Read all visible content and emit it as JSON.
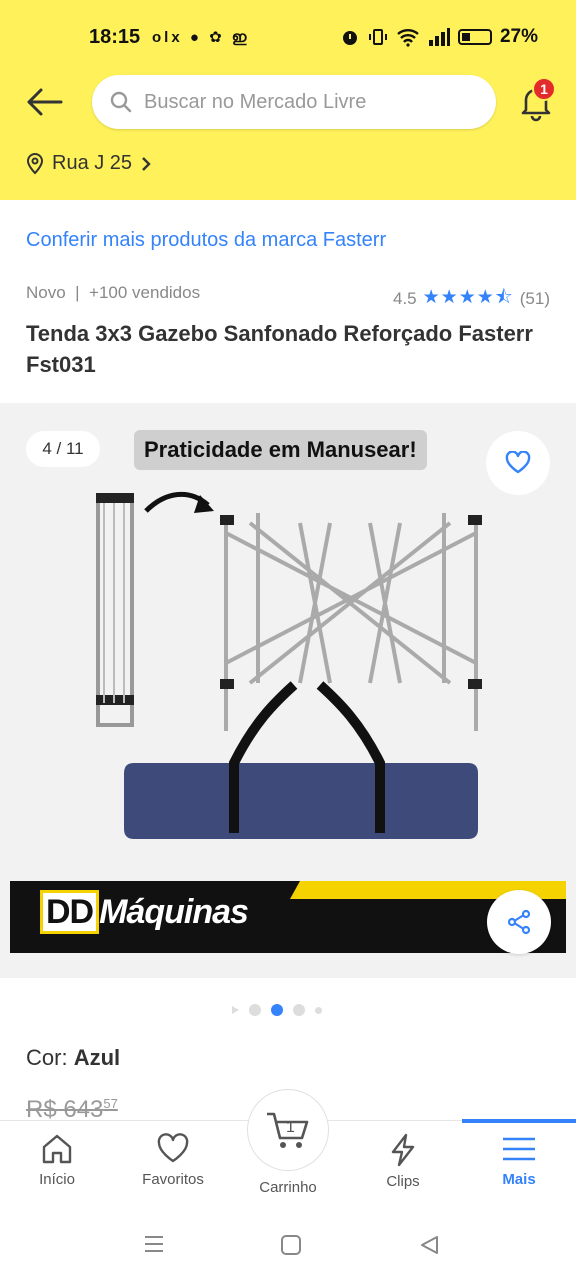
{
  "status_bar": {
    "time": "18:15",
    "app_icons": "olx ● ✿ ഇ",
    "battery": "27%"
  },
  "header": {
    "search_placeholder": "Buscar no Mercado Livre",
    "notification_count": "1",
    "address": "Rua J 25",
    "background_color": "#fff159"
  },
  "product": {
    "brand_link": "Conferir mais produtos da marca Fasterr",
    "condition": "Novo",
    "sold": "+100 vendidos",
    "rating_value": "4.5",
    "rating_count": "(51)",
    "rating_stars": 4.5,
    "title": "Tenda 3x3 Gazebo Sanfonado Reforçado Fasterr Fst031",
    "gallery": {
      "counter": "4 / 11",
      "image_caption": "Praticidade em Manusear!",
      "image_brand": "DDMáquinas",
      "image_brand_dd": "DD",
      "image_brand_rest": "Máquinas"
    },
    "color_label": "Cor: ",
    "color_value": "Azul",
    "old_price": "R$ 643",
    "old_price_cents": "57"
  },
  "bottom_nav": {
    "items": [
      {
        "label": "Início",
        "icon": "home-icon"
      },
      {
        "label": "Favoritos",
        "icon": "heart-icon"
      },
      {
        "label": "Carrinho",
        "icon": "cart-icon",
        "badge": "1"
      },
      {
        "label": "Clips",
        "icon": "bolt-icon"
      },
      {
        "label": "Mais",
        "icon": "menu-icon"
      }
    ],
    "active_color": "#3483fa"
  }
}
